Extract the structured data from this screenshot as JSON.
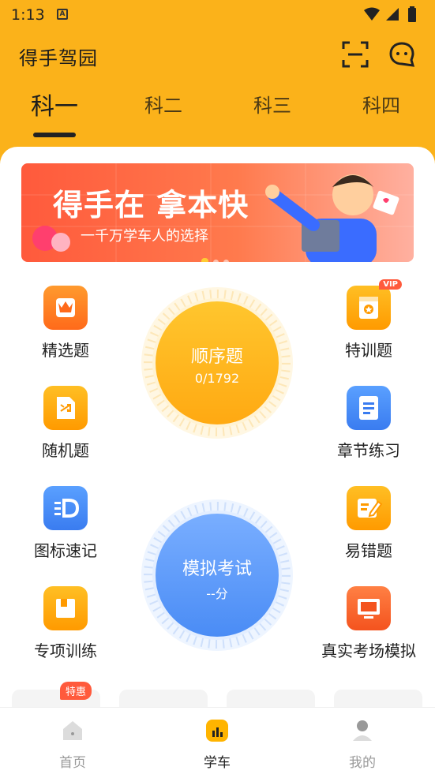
{
  "status": {
    "time": "1:13",
    "notification_letter": "A"
  },
  "header": {
    "app_title": "得手驾园"
  },
  "tabs": [
    {
      "label": "科一",
      "active": true
    },
    {
      "label": "科二",
      "active": false
    },
    {
      "label": "科三",
      "active": false
    },
    {
      "label": "科四",
      "active": false
    }
  ],
  "banner": {
    "title": "得手在 拿本快",
    "subtitle": "一千万学车人的选择",
    "page_count": 3,
    "active_index": 0
  },
  "features": {
    "jingxuan": "精选题",
    "texun": "特训题",
    "suiji": "随机题",
    "zhangjie": "章节练习",
    "tubiao": "图标速记",
    "yicuo": "易错题",
    "zhuanxiang": "专项训练",
    "zhenshi": "真实考场模拟",
    "vip_badge": "VIP"
  },
  "sequence": {
    "title": "顺序题",
    "progress": "0/1792"
  },
  "mock_exam": {
    "title": "模拟考试",
    "score": "--分"
  },
  "promo": {
    "tehui": "特惠"
  },
  "bottom_nav": [
    {
      "label": "首页",
      "active": false
    },
    {
      "label": "学车",
      "active": true
    },
    {
      "label": "我的",
      "active": false
    }
  ],
  "colors": {
    "brand_yellow": "#fbb21a",
    "orange": "#ff6a1a",
    "blue": "#3a7cf0"
  }
}
